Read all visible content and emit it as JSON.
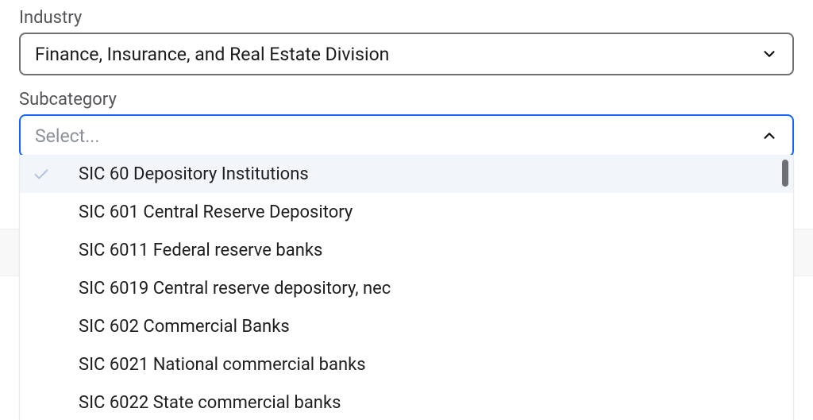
{
  "industry": {
    "label": "Industry",
    "value": "Finance, Insurance, and Real Estate Division"
  },
  "subcategory": {
    "label": "Subcategory",
    "placeholder": "Select...",
    "options": [
      "SIC 60 Depository Institutions",
      "SIC 601 Central Reserve Depository",
      "SIC 6011 Federal reserve banks",
      "SIC 6019 Central reserve depository, nec",
      "SIC 602 Commercial Banks",
      "SIC 6021 National commercial banks",
      "SIC 6022 State commercial banks"
    ]
  }
}
